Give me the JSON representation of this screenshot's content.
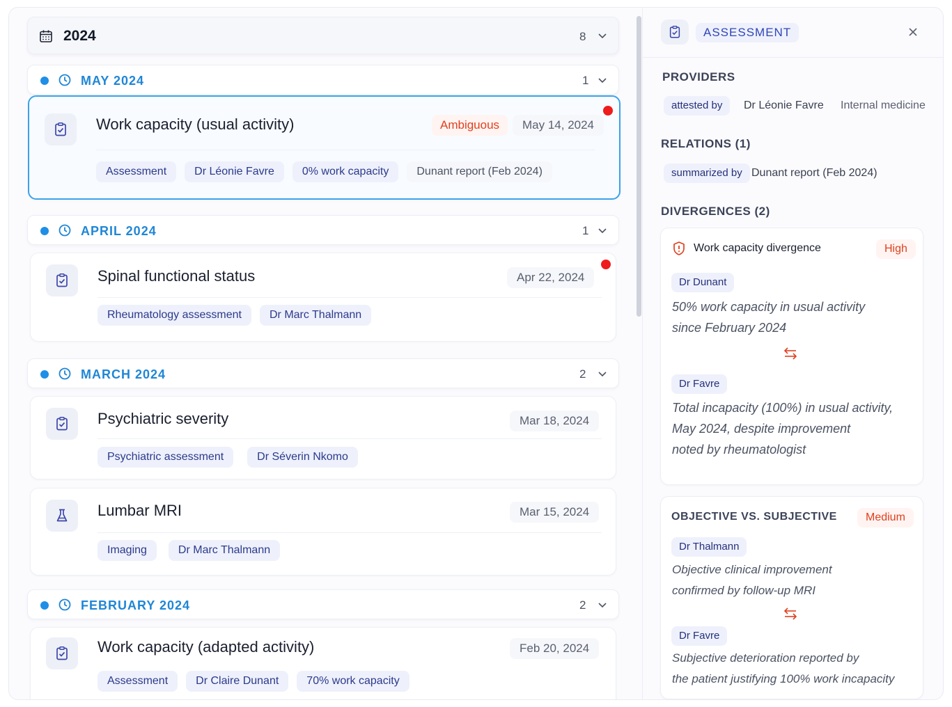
{
  "timeline": {
    "year": {
      "label": "2024",
      "count": "8"
    },
    "months": [
      {
        "label": "MAY 2024",
        "count": "1"
      },
      {
        "label": "APRIL 2024",
        "count": "1"
      },
      {
        "label": "MARCH 2024",
        "count": "2"
      },
      {
        "label": "FEBRUARY 2024",
        "count": "2"
      }
    ],
    "entries": [
      {
        "title": "Work capacity (usual activity)",
        "date": "May 14, 2024",
        "flag": "Ambiguous",
        "tags": [
          "Assessment",
          "Dr Léonie Favre",
          "0% work capacity",
          "Dunant report (Feb 2024)"
        ]
      },
      {
        "title": "Spinal functional status",
        "date": "Apr 22, 2024",
        "tags": [
          "Rheumatology assessment",
          "Dr Marc Thalmann"
        ]
      },
      {
        "title": "Psychiatric severity",
        "date": "Mar 18, 2024",
        "tags": [
          "Psychiatric assessment",
          "Dr Séverin Nkomo"
        ]
      },
      {
        "title": "Lumbar MRI",
        "date": "Mar 15, 2024",
        "tags": [
          "Imaging",
          "Dr Marc Thalmann"
        ]
      },
      {
        "title": "Work capacity (adapted activity)",
        "date": "Feb 20, 2024",
        "tags": [
          "Assessment",
          "Dr Claire Dunant",
          "70% work capacity"
        ]
      }
    ]
  },
  "panel": {
    "title": "ASSESSMENT",
    "providers": {
      "heading": "PROVIDERS",
      "relation": "attested by",
      "name": "Dr Léonie Favre",
      "specialty": "Internal medicine"
    },
    "relations": {
      "heading": "RELATIONS (1)",
      "relation": "summarized by",
      "target": "Dunant report (Feb 2024)"
    },
    "divergences": {
      "heading": "DIVERGENCES (2)",
      "items": [
        {
          "title": "Work capacity divergence",
          "severity": "High",
          "a_who": "Dr Dunant",
          "a_line1": "50% work capacity in usual activity",
          "a_line2": "since February 2024",
          "b_who": "Dr Favre",
          "b_line1": "Total incapacity (100%) in usual activity,",
          "b_line2": "May 2024, despite improvement",
          "b_line3": "noted by rheumatologist"
        },
        {
          "title": "OBJECTIVE VS. SUBJECTIVE",
          "severity": "Medium",
          "a_who": "Dr Thalmann",
          "a_line1": "Objective clinical improvement",
          "a_line2": "confirmed by follow-up MRI",
          "b_who": "Dr Favre",
          "b_line1": "Subjective deterioration reported by",
          "b_line2": "the patient justifying 100% work incapacity"
        }
      ]
    }
  },
  "colors": {
    "accent": "#1f86d6",
    "selected_border": "#3aa3ea",
    "alert": "#ee1c1c",
    "badge_text": "#e0401f"
  }
}
